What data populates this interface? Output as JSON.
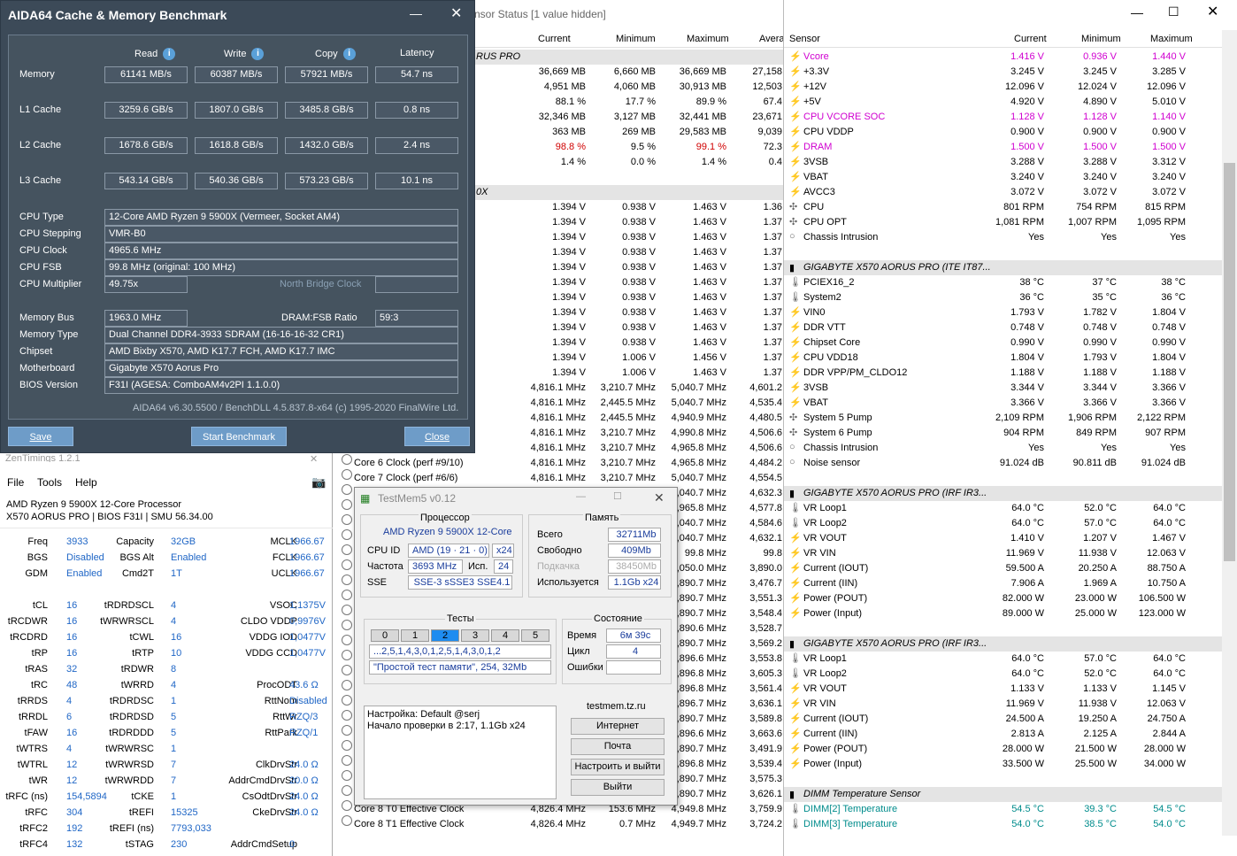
{
  "hwl": {
    "title": "nsor Status [1 value hidden]",
    "cols": [
      "Current",
      "Minimum",
      "Maximum",
      "Avera"
    ],
    "rows": [
      {
        "t": "grp",
        "n": "RUS PRO"
      },
      {
        "n": "",
        "v": [
          "36,669 MB",
          "6,660 MB",
          "36,669 MB",
          "27,158"
        ]
      },
      {
        "n": "",
        "v": [
          "4,951 MB",
          "4,060 MB",
          "30,913 MB",
          "12,503"
        ]
      },
      {
        "n": "",
        "v": [
          "88.1 %",
          "17.7 %",
          "89.9 %",
          "67.4"
        ]
      },
      {
        "n": "",
        "v": [
          "32,346 MB",
          "3,127 MB",
          "32,441 MB",
          "23,671"
        ]
      },
      {
        "n": "",
        "v": [
          "363 MB",
          "269 MB",
          "29,583 MB",
          "9,039"
        ]
      },
      {
        "n": "",
        "v": [
          "98.8 %",
          "9.5 %",
          "99.1 %",
          "72.3"
        ],
        "c": "red"
      },
      {
        "n": "",
        "v": [
          "1.4 %",
          "0.0 %",
          "1.4 %",
          "0.4"
        ]
      },
      {
        "t": "blank"
      },
      {
        "t": "grp",
        "n": "0X"
      },
      {
        "n": "",
        "v": [
          "1.394 V",
          "0.938 V",
          "1.463 V",
          "1.36"
        ]
      },
      {
        "n": "",
        "v": [
          "1.394 V",
          "0.938 V",
          "1.463 V",
          "1.37"
        ]
      },
      {
        "n": "",
        "v": [
          "1.394 V",
          "0.938 V",
          "1.463 V",
          "1.37"
        ]
      },
      {
        "n": "",
        "v": [
          "1.394 V",
          "0.938 V",
          "1.463 V",
          "1.37"
        ]
      },
      {
        "n": "",
        "v": [
          "1.394 V",
          "0.938 V",
          "1.463 V",
          "1.37"
        ]
      },
      {
        "n": "",
        "v": [
          "1.394 V",
          "0.938 V",
          "1.463 V",
          "1.37"
        ]
      },
      {
        "n": "",
        "v": [
          "1.394 V",
          "0.938 V",
          "1.463 V",
          "1.37"
        ]
      },
      {
        "n": "",
        "v": [
          "1.394 V",
          "0.938 V",
          "1.463 V",
          "1.37"
        ]
      },
      {
        "n": "",
        "v": [
          "1.394 V",
          "0.938 V",
          "1.463 V",
          "1.37"
        ]
      },
      {
        "n": "",
        "v": [
          "1.394 V",
          "0.938 V",
          "1.463 V",
          "1.37"
        ]
      },
      {
        "n": "",
        "v": [
          "1.394 V",
          "1.006 V",
          "1.456 V",
          "1.37"
        ]
      },
      {
        "n": "",
        "v": [
          "1.394 V",
          "1.006 V",
          "1.463 V",
          "1.37"
        ]
      },
      {
        "n": "",
        "v": [
          "4,816.1 MHz",
          "3,210.7 MHz",
          "5,040.7 MHz",
          "4,601.2"
        ]
      },
      {
        "n": "",
        "v": [
          "4,816.1 MHz",
          "2,445.5 MHz",
          "5,040.7 MHz",
          "4,535.4"
        ]
      },
      {
        "n": "",
        "v": [
          "4,816.1 MHz",
          "2,445.5 MHz",
          "4,940.9 MHz",
          "4,480.5"
        ]
      },
      {
        "n": "",
        "v": [
          "4,816.1 MHz",
          "3,210.7 MHz",
          "4,990.8 MHz",
          "4,506.6"
        ]
      },
      {
        "n": "",
        "v": [
          "4,816.1 MHz",
          "3,210.7 MHz",
          "4,965.8 MHz",
          "4,506.6"
        ]
      },
      {
        "n": "Core 6 Clock (perf #9/10)",
        "v": [
          "4,816.1 MHz",
          "3,210.7 MHz",
          "4,965.8 MHz",
          "4,484.2"
        ]
      },
      {
        "n": "Core 7 Clock (perf #6/6)",
        "v": [
          "4,816.1 MHz",
          "3,210.7 MHz",
          "5,040.7 MHz",
          "4,554.5"
        ]
      },
      {
        "n": "",
        "v": [
          "",
          "",
          "5,040.7 MHz",
          "4,632.3"
        ]
      },
      {
        "n": "",
        "v": [
          "",
          "",
          "4,965.8 MHz",
          "4,577.8"
        ]
      },
      {
        "n": "",
        "v": [
          "",
          "",
          "5,040.7 MHz",
          "4,584.6"
        ]
      },
      {
        "n": "",
        "v": [
          "",
          "",
          "5,040.7 MHz",
          "4,632.1"
        ]
      },
      {
        "n": "",
        "v": [
          "",
          "",
          "99.8 MHz",
          "99.8"
        ]
      },
      {
        "n": "",
        "v": [
          "",
          "",
          "4,050.0 MHz",
          "3,890.0"
        ]
      },
      {
        "n": "",
        "v": [
          "",
          "",
          "3,890.7 MHz",
          "3,476.7"
        ]
      },
      {
        "n": "",
        "v": [
          "",
          "",
          "3,890.7 MHz",
          "3,551.3"
        ]
      },
      {
        "n": "",
        "v": [
          "",
          "",
          "3,890.7 MHz",
          "3,548.4"
        ]
      },
      {
        "n": "",
        "v": [
          "",
          "",
          "3,890.6 MHz",
          "3,528.7"
        ]
      },
      {
        "n": "",
        "v": [
          "",
          "",
          "3,890.7 MHz",
          "3,569.2"
        ]
      },
      {
        "n": "",
        "v": [
          "",
          "",
          "3,896.6 MHz",
          "3,553.8"
        ]
      },
      {
        "n": "",
        "v": [
          "",
          "",
          "3,896.8 MHz",
          "3,605.3"
        ]
      },
      {
        "n": "",
        "v": [
          "",
          "",
          "3,896.8 MHz",
          "3,561.4"
        ]
      },
      {
        "n": "",
        "v": [
          "",
          "",
          "3,896.7 MHz",
          "3,636.1"
        ]
      },
      {
        "n": "",
        "v": [
          "",
          "",
          "3,890.7 MHz",
          "3,589.8"
        ]
      },
      {
        "n": "",
        "v": [
          "",
          "",
          "3,896.6 MHz",
          "3,663.6"
        ]
      },
      {
        "n": "",
        "v": [
          "",
          "",
          "3,890.7 MHz",
          "3,491.9"
        ]
      },
      {
        "n": "",
        "v": [
          "",
          "",
          "3,896.8 MHz",
          "3,539.4"
        ]
      },
      {
        "n": "",
        "v": [
          "",
          "",
          "3,890.7 MHz",
          "3,575.3"
        ]
      },
      {
        "n": "",
        "v": [
          "",
          "",
          "3,890.7 MHz",
          "3,626.1"
        ]
      },
      {
        "n": "Core 8 T0 Effective Clock",
        "v": [
          "4,826.4 MHz",
          "153.6 MHz",
          "4,949.8 MHz",
          "3,759.9"
        ]
      },
      {
        "n": "Core 8 T1 Effective Clock",
        "v": [
          "4,826.4 MHz",
          "0.7 MHz",
          "4,949.7 MHz",
          "3,724.2"
        ]
      }
    ]
  },
  "hwr": {
    "cols": [
      "Sensor",
      "Current",
      "Minimum",
      "Maximum"
    ],
    "rows": [
      {
        "n": "Vcore",
        "v": [
          "1.416 V",
          "0.936 V",
          "1.440 V"
        ],
        "c": "mag",
        "i": "⚡"
      },
      {
        "n": "+3.3V",
        "v": [
          "3.245 V",
          "3.245 V",
          "3.285 V"
        ],
        "i": "⚡"
      },
      {
        "n": "+12V",
        "v": [
          "12.096 V",
          "12.024 V",
          "12.096 V"
        ],
        "i": "⚡"
      },
      {
        "n": "+5V",
        "v": [
          "4.920 V",
          "4.890 V",
          "5.010 V"
        ],
        "i": "⚡"
      },
      {
        "n": "CPU VCORE SOC",
        "v": [
          "1.128 V",
          "1.128 V",
          "1.140 V"
        ],
        "c": "mag",
        "i": "⚡"
      },
      {
        "n": "CPU VDDP",
        "v": [
          "0.900 V",
          "0.900 V",
          "0.900 V"
        ],
        "i": "⚡"
      },
      {
        "n": "DRAM",
        "v": [
          "1.500 V",
          "1.500 V",
          "1.500 V"
        ],
        "c": "mag",
        "i": "⚡"
      },
      {
        "n": "3VSB",
        "v": [
          "3.288 V",
          "3.288 V",
          "3.312 V"
        ],
        "i": "⚡"
      },
      {
        "n": "VBAT",
        "v": [
          "3.240 V",
          "3.240 V",
          "3.240 V"
        ],
        "i": "⚡"
      },
      {
        "n": "AVCC3",
        "v": [
          "3.072 V",
          "3.072 V",
          "3.072 V"
        ],
        "i": "⚡"
      },
      {
        "n": "CPU",
        "v": [
          "801 RPM",
          "754 RPM",
          "815 RPM"
        ],
        "i": "✣"
      },
      {
        "n": "CPU OPT",
        "v": [
          "1,081 RPM",
          "1,007 RPM",
          "1,095 RPM"
        ],
        "i": "✣"
      },
      {
        "n": "Chassis Intrusion",
        "v": [
          "Yes",
          "Yes",
          "Yes"
        ],
        "i": "○"
      },
      {
        "t": "blank"
      },
      {
        "t": "grp",
        "n": "GIGABYTE X570 AORUS PRO (ITE IT87..."
      },
      {
        "n": "PCIEX16_2",
        "v": [
          "38 °C",
          "37 °C",
          "38 °C"
        ],
        "i": "🌡"
      },
      {
        "n": "System2",
        "v": [
          "36 °C",
          "35 °C",
          "36 °C"
        ],
        "i": "🌡"
      },
      {
        "n": "VIN0",
        "v": [
          "1.793 V",
          "1.782 V",
          "1.804 V"
        ],
        "i": "⚡"
      },
      {
        "n": "DDR VTT",
        "v": [
          "0.748 V",
          "0.748 V",
          "0.748 V"
        ],
        "i": "⚡"
      },
      {
        "n": "Chipset Core",
        "v": [
          "0.990 V",
          "0.990 V",
          "0.990 V"
        ],
        "i": "⚡"
      },
      {
        "n": "CPU VDD18",
        "v": [
          "1.804 V",
          "1.793 V",
          "1.804 V"
        ],
        "i": "⚡"
      },
      {
        "n": "DDR VPP/PM_CLDO12",
        "v": [
          "1.188 V",
          "1.188 V",
          "1.188 V"
        ],
        "i": "⚡"
      },
      {
        "n": "3VSB",
        "v": [
          "3.344 V",
          "3.344 V",
          "3.366 V"
        ],
        "i": "⚡"
      },
      {
        "n": "VBAT",
        "v": [
          "3.366 V",
          "3.366 V",
          "3.366 V"
        ],
        "i": "⚡"
      },
      {
        "n": "System 5 Pump",
        "v": [
          "2,109 RPM",
          "1,906 RPM",
          "2,122 RPM"
        ],
        "i": "✣"
      },
      {
        "n": "System 6 Pump",
        "v": [
          "904 RPM",
          "849 RPM",
          "907 RPM"
        ],
        "i": "✣"
      },
      {
        "n": "Chassis Intrusion",
        "v": [
          "Yes",
          "Yes",
          "Yes"
        ],
        "i": "○"
      },
      {
        "n": "Noise sensor",
        "v": [
          "91.024 dB",
          "90.811 dB",
          "91.024 dB"
        ],
        "i": "○"
      },
      {
        "t": "blank"
      },
      {
        "t": "grp",
        "n": "GIGABYTE X570 AORUS PRO (IRF IR3..."
      },
      {
        "n": "VR Loop1",
        "v": [
          "64.0 °C",
          "52.0 °C",
          "64.0 °C"
        ],
        "i": "🌡"
      },
      {
        "n": "VR Loop2",
        "v": [
          "64.0 °C",
          "57.0 °C",
          "64.0 °C"
        ],
        "i": "🌡"
      },
      {
        "n": "VR VOUT",
        "v": [
          "1.410 V",
          "1.207 V",
          "1.467 V"
        ],
        "i": "⚡"
      },
      {
        "n": "VR VIN",
        "v": [
          "11.969 V",
          "11.938 V",
          "12.063 V"
        ],
        "i": "⚡"
      },
      {
        "n": "Current (IOUT)",
        "v": [
          "59.500 A",
          "20.250 A",
          "88.750 A"
        ],
        "i": "⚡"
      },
      {
        "n": "Current (IIN)",
        "v": [
          "7.906 A",
          "1.969 A",
          "10.750 A"
        ],
        "i": "⚡"
      },
      {
        "n": "Power (POUT)",
        "v": [
          "82.000 W",
          "23.000 W",
          "106.500 W"
        ],
        "i": "⚡"
      },
      {
        "n": "Power (Input)",
        "v": [
          "89.000 W",
          "25.000 W",
          "123.000 W"
        ],
        "i": "⚡"
      },
      {
        "t": "blank"
      },
      {
        "t": "grp",
        "n": "GIGABYTE X570 AORUS PRO (IRF IR3..."
      },
      {
        "n": "VR Loop1",
        "v": [
          "64.0 °C",
          "57.0 °C",
          "64.0 °C"
        ],
        "i": "🌡"
      },
      {
        "n": "VR Loop2",
        "v": [
          "64.0 °C",
          "52.0 °C",
          "64.0 °C"
        ],
        "i": "🌡"
      },
      {
        "n": "VR VOUT",
        "v": [
          "1.133 V",
          "1.133 V",
          "1.145 V"
        ],
        "i": "⚡"
      },
      {
        "n": "VR VIN",
        "v": [
          "11.969 V",
          "11.938 V",
          "12.063 V"
        ],
        "i": "⚡"
      },
      {
        "n": "Current (IOUT)",
        "v": [
          "24.500 A",
          "19.250 A",
          "24.750 A"
        ],
        "i": "⚡"
      },
      {
        "n": "Current (IIN)",
        "v": [
          "2.813 A",
          "2.125 A",
          "2.844 A"
        ],
        "i": "⚡"
      },
      {
        "n": "Power (POUT)",
        "v": [
          "28.000 W",
          "21.500 W",
          "28.000 W"
        ],
        "i": "⚡"
      },
      {
        "n": "Power (Input)",
        "v": [
          "33.500 W",
          "25.500 W",
          "34.000 W"
        ],
        "i": "⚡"
      },
      {
        "t": "blank"
      },
      {
        "t": "grp",
        "n": "DIMM Temperature Sensor"
      },
      {
        "n": "DIMM[2] Temperature",
        "v": [
          "54.5 °C",
          "39.3 °C",
          "54.5 °C"
        ],
        "c": "teal",
        "i": "🌡"
      },
      {
        "n": "DIMM[3] Temperature",
        "v": [
          "54.0 °C",
          "38.5 °C",
          "54.0 °C"
        ],
        "c": "teal",
        "i": "🌡"
      }
    ]
  },
  "aida": {
    "title": "AIDA64 Cache & Memory Benchmark",
    "h": [
      "Read",
      "Write",
      "Copy",
      "Latency"
    ],
    "bench": [
      {
        "l": "Memory",
        "v": [
          "61141 MB/s",
          "60387 MB/s",
          "57921 MB/s",
          "54.7 ns"
        ]
      },
      {
        "l": "L1 Cache",
        "v": [
          "3259.6 GB/s",
          "1807.0 GB/s",
          "3485.8 GB/s",
          "0.8 ns"
        ]
      },
      {
        "l": "L2 Cache",
        "v": [
          "1678.6 GB/s",
          "1618.8 GB/s",
          "1432.0 GB/s",
          "2.4 ns"
        ]
      },
      {
        "l": "L3 Cache",
        "v": [
          "543.14 GB/s",
          "540.36 GB/s",
          "573.23 GB/s",
          "10.1 ns"
        ]
      }
    ],
    "cpu_type_l": "CPU Type",
    "cpu_type": "12-Core AMD Ryzen 9 5900X  (Vermeer, Socket AM4)",
    "cpu_step_l": "CPU Stepping",
    "cpu_step": "VMR-B0",
    "cpu_clock_l": "CPU Clock",
    "cpu_clock": "4965.6 MHz",
    "cpu_fsb_l": "CPU FSB",
    "cpu_fsb": "99.8 MHz  (original: 100 MHz)",
    "cpu_mult_l": "CPU Multiplier",
    "cpu_mult": "49.75x",
    "nb_l": "North Bridge Clock",
    "mem_bus_l": "Memory Bus",
    "mem_bus": "1963.0 MHz",
    "ratio_l": "DRAM:FSB Ratio",
    "ratio": "59:3",
    "mem_type_l": "Memory Type",
    "mem_type": "Dual Channel DDR4-3933 SDRAM  (16-16-16-32 CR1)",
    "chipset_l": "Chipset",
    "chipset": "AMD Bixby X570, AMD K17.7 FCH, AMD K17.7 IMC",
    "mb_l": "Motherboard",
    "mb": "Gigabyte X570 Aorus Pro",
    "bios_l": "BIOS Version",
    "bios": "F31I  (AGESA: ComboAM4v2PI 1.1.0.0)",
    "footer": "AIDA64 v6.30.5500 / BenchDLL 4.5.837.8-x64  (c) 1995-2020 FinalWire Ltd.",
    "save": "Save",
    "start": "Start Benchmark",
    "close": "Close"
  },
  "zen": {
    "title": "ZenTimings 1.2.1",
    "menu": [
      "File",
      "Tools",
      "Help"
    ],
    "line1": "AMD Ryzen 9 5900X 12-Core Processor",
    "line2": "X570 AORUS PRO | BIOS F31I | SMU 56.34.00",
    "top": [
      [
        "Freq",
        "3933",
        "Capacity",
        "32GB",
        "MCLK",
        "1966.67"
      ],
      [
        "BGS",
        "Disabled",
        "BGS Alt",
        "Enabled",
        "FCLK",
        "1966.67"
      ],
      [
        "GDM",
        "Enabled",
        "Cmd2T",
        "1T",
        "UCLK",
        "1966.67"
      ]
    ],
    "t": [
      [
        "tCL",
        "16",
        "tRDRDSCL",
        "4",
        "VSOC",
        "1,1375V"
      ],
      [
        "tRCDWR",
        "16",
        "tWRWRSCL",
        "4",
        "CLDO VDDP",
        "0,9976V"
      ],
      [
        "tRCDRD",
        "16",
        "tCWL",
        "16",
        "VDDG IOD",
        "1,0477V"
      ],
      [
        "tRP",
        "16",
        "tRTP",
        "10",
        "VDDG CCD",
        "1,0477V"
      ],
      [
        "tRAS",
        "32",
        "tRDWR",
        "8",
        "",
        ""
      ],
      [
        "tRC",
        "48",
        "tWRRD",
        "4",
        "ProcODT",
        "43.6 Ω"
      ],
      [
        "tRRDS",
        "4",
        "tRDRDSC",
        "1",
        "RttNom",
        "Disabled"
      ],
      [
        "tRRDL",
        "6",
        "tRDRDSD",
        "5",
        "RttWr",
        "RZQ/3"
      ],
      [
        "tFAW",
        "16",
        "tRDRDDD",
        "5",
        "RttPark",
        "RZQ/1"
      ],
      [
        "tWTRS",
        "4",
        "tWRWRSC",
        "1",
        "",
        ""
      ],
      [
        "tWTRL",
        "12",
        "tWRWRSD",
        "7",
        "ClkDrvStr",
        "24.0 Ω"
      ],
      [
        "tWR",
        "12",
        "tWRWRDD",
        "7",
        "AddrCmdDrvStr",
        "20.0 Ω"
      ],
      [
        "tRFC (ns)",
        "154,5894",
        "tCKE",
        "1",
        "CsOdtDrvStr",
        "24.0 Ω"
      ],
      [
        "tRFC",
        "304",
        "tREFI",
        "15325",
        "CkeDrvStr",
        "24.0 Ω"
      ],
      [
        "tRFC2",
        "192",
        "tREFI (ns)",
        "7793,033",
        "",
        ""
      ],
      [
        "tRFC4",
        "132",
        "tSTAG",
        "230",
        "AddrCmdSetup",
        "0"
      ]
    ]
  },
  "tm": {
    "title": "TestMem5 v0.12",
    "proc_h": "Процессор",
    "cpu": "AMD Ryzen 9 5900X 12-Core",
    "cpuid_l": "CPU ID",
    "cpuid": "AMD  (19 · 21 · 0)",
    "x24": "x24",
    "freq_l": "Частота",
    "freq": "3693 MHz",
    "isp_l": "Исп.",
    "isp": "24",
    "sse_l": "SSE",
    "sse": "SSE-3 sSSE3 SSE4.1",
    "mem_h": "Память",
    "total_l": "Всего",
    "total": "32711Mb",
    "free_l": "Свободно",
    "free": "409Mb",
    "swap_l": "Подкачка",
    "swap": "38450Mb",
    "used_l": "Используется",
    "used": "1.1Gb x24",
    "tests_h": "Тесты",
    "tests": [
      "0",
      "1",
      "2",
      "3",
      "4",
      "5"
    ],
    "seq": "...2,5,1,4,3,0,1,2,5,1,4,3,0,1,2",
    "test_name": "\"Простой тест памяти\", 254, 32Mb",
    "state_h": "Состояние",
    "time_l": "Время",
    "time": "6м 39с",
    "cycle_l": "Цикл",
    "cycle": "4",
    "err_l": "Ошибки",
    "err": "",
    "log1": "Настройка: Default @serj",
    "log2": "Начало проверки в 2:17, 1.1Gb x24",
    "site": "testmem.tz.ru",
    "b1": "Интернет",
    "b2": "Почта",
    "b3": "Настроить и выйти",
    "b4": "Выйти"
  }
}
